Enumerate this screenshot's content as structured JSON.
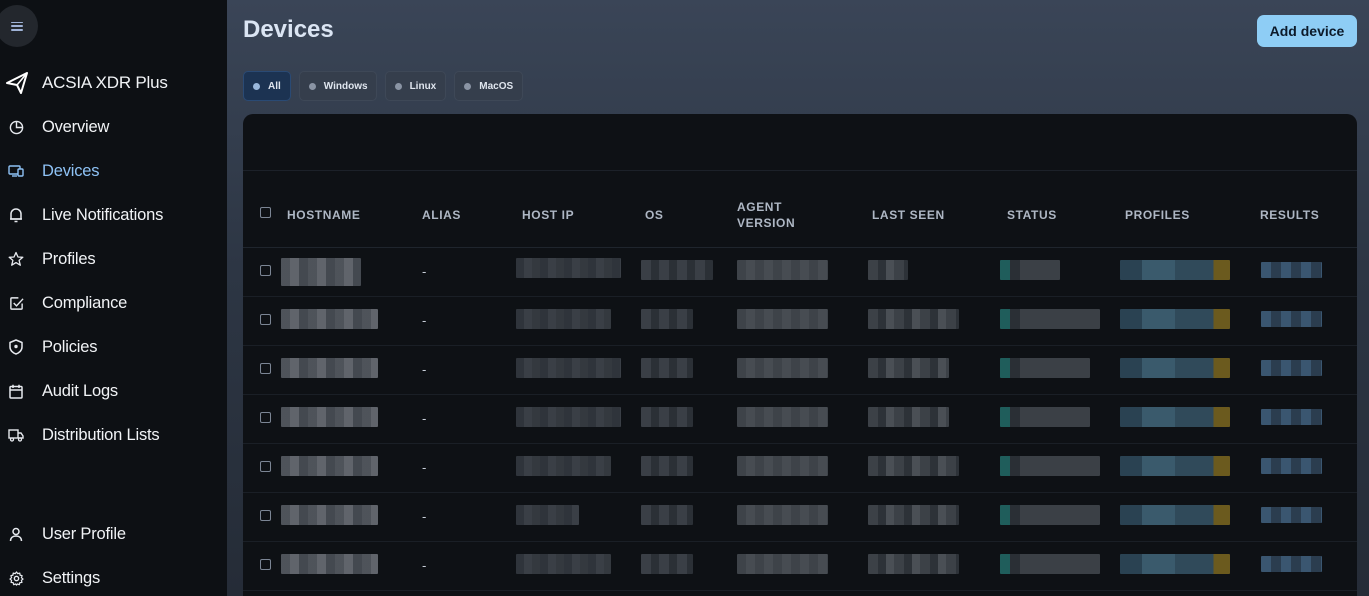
{
  "app": {
    "brand": "ACSIA XDR Plus"
  },
  "sidebar": {
    "items": [
      {
        "label": "Overview",
        "icon": "pie-chart-icon"
      },
      {
        "label": "Devices",
        "icon": "devices-icon",
        "active": true
      },
      {
        "label": "Live Notifications",
        "icon": "bell-icon"
      },
      {
        "label": "Profiles",
        "icon": "star-icon"
      },
      {
        "label": "Compliance",
        "icon": "check-square-icon"
      },
      {
        "label": "Policies",
        "icon": "shield-icon"
      },
      {
        "label": "Audit Logs",
        "icon": "calendar-icon"
      },
      {
        "label": "Distribution Lists",
        "icon": "truck-icon"
      }
    ],
    "bottom": [
      {
        "label": "User Profile",
        "icon": "user-icon"
      },
      {
        "label": "Settings",
        "icon": "gear-icon"
      }
    ]
  },
  "header": {
    "title": "Devices",
    "add_label": "Add device"
  },
  "filters": [
    {
      "label": "All",
      "active": true
    },
    {
      "label": "Windows"
    },
    {
      "label": "Linux"
    },
    {
      "label": "MacOS"
    }
  ],
  "table": {
    "columns": [
      "HOSTNAME",
      "ALIAS",
      "HOST IP",
      "OS",
      "AGENT VERSION",
      "LAST SEEN",
      "STATUS",
      "PROFILES",
      "RESULTS"
    ],
    "rows": [
      {
        "alias": "-"
      },
      {
        "alias": "-"
      },
      {
        "alias": "-"
      },
      {
        "alias": "-"
      },
      {
        "alias": "-"
      },
      {
        "alias": "-"
      },
      {
        "alias": "-"
      }
    ]
  },
  "colors": {
    "accent": "#8ecdf5",
    "active_nav": "#8ec2f5",
    "active_chip": "#1c3352"
  }
}
